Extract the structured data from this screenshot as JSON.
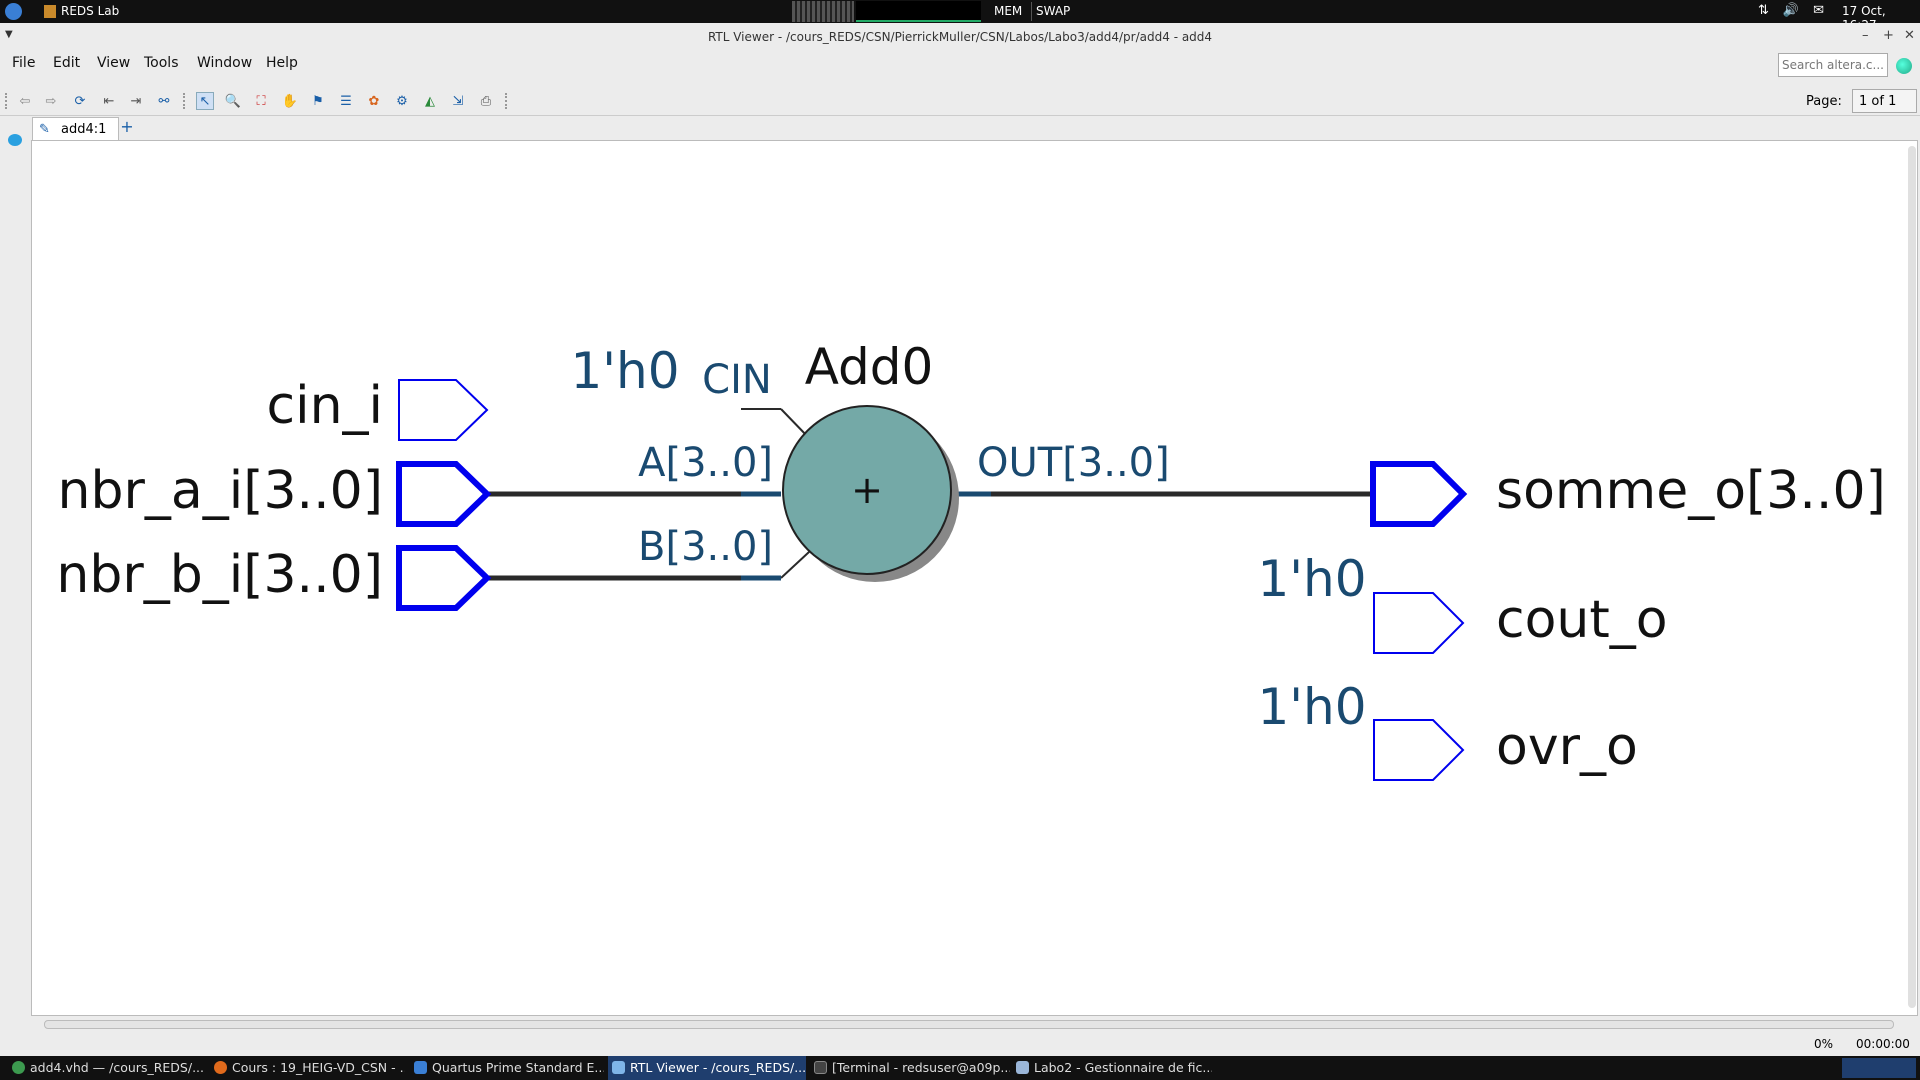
{
  "top_panel": {
    "app_name": "REDS Lab",
    "mem_label": "MEM",
    "swap_label": "SWAP",
    "clock": "17 Oct, 16:27"
  },
  "window": {
    "title": "RTL Viewer - /cours_REDS/CSN/PierrickMuller/CSN/Labos/Labo3/add4/pr/add4 - add4",
    "minimize": "–",
    "maximize": "+",
    "close": "✕"
  },
  "menu": {
    "file": "File",
    "edit": "Edit",
    "view": "View",
    "tools": "Tools",
    "window": "Window",
    "help": "Help",
    "search_placeholder": "Search altera.c..."
  },
  "toolbar": {
    "page_label": "Page:",
    "page_value": "1 of 1"
  },
  "tabs": {
    "active": "add4:1",
    "add": "+"
  },
  "schematic": {
    "inputs": {
      "cin": "cin_i",
      "a": "nbr_a_i[3..0]",
      "b": "nbr_b_i[3..0]"
    },
    "adder": {
      "name": "Add0",
      "symbol": "+",
      "cin_const": "1'h0",
      "cin_port": "CIN",
      "a_port": "A[3..0]",
      "b_port": "B[3..0]",
      "out_port": "OUT[3..0]"
    },
    "outputs": {
      "somme": "somme_o[3..0]",
      "cout": "cout_o",
      "ovr": "ovr_o",
      "cout_const": "1'h0",
      "ovr_const": "1'h0"
    },
    "colors": {
      "port_blue": "#0000ee",
      "label_teal": "#1a4a70",
      "adder_fill": "#74a9a7",
      "wire": "#2a2a2a"
    }
  },
  "status": {
    "progress": "0%",
    "elapsed": "00:00:00"
  },
  "taskbar": {
    "items": [
      "add4.vhd — /cours_REDS/...",
      "Cours : 19_HEIG-VD_CSN - ...",
      "Quartus Prime Standard E...",
      "RTL Viewer - /cours_REDS/...",
      "[Terminal - redsuser@a09p...",
      "Labo2 - Gestionnaire de fic..."
    ]
  }
}
